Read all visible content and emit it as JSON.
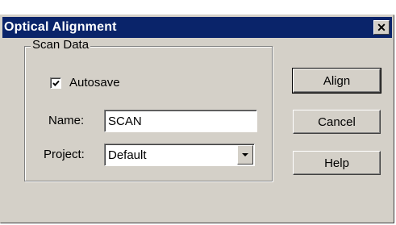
{
  "window": {
    "title": "Optical Alignment",
    "close_label": "✕"
  },
  "scan_group": {
    "legend": "Scan Data",
    "autosave": {
      "label": "Autosave",
      "checked": true
    },
    "name": {
      "label": "Name:",
      "value": "SCAN"
    },
    "project": {
      "label": "Project:",
      "selected": "Default"
    }
  },
  "buttons": {
    "align": "Align",
    "cancel": "Cancel",
    "help": "Help"
  },
  "colors": {
    "titlebar": "#0a246a",
    "face": "#d4d0c8"
  }
}
